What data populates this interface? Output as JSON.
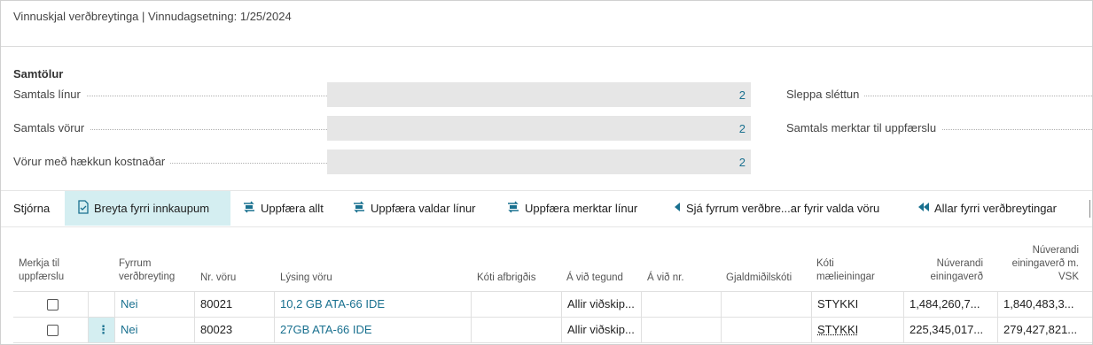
{
  "header": {
    "title": "Vinnuskjal verðbreytinga | Vinnudagsetning: 1/25/2024"
  },
  "summary": {
    "heading": "Samtölur",
    "left_fields": [
      {
        "label": "Samtals línur",
        "value": "2"
      },
      {
        "label": "Samtals vörur",
        "value": "2"
      },
      {
        "label": "Vörur með hækkun kostnaðar",
        "value": "2"
      }
    ],
    "right_fields": [
      {
        "label": "Sleppa sléttun"
      },
      {
        "label": "Samtals merktar til uppfærslu"
      }
    ]
  },
  "actions": {
    "manage": "Stjórna",
    "change_purchases": "Breyta fyrri innkaupum",
    "update_all": "Uppfæra allt",
    "update_selected": "Uppfæra valdar línur",
    "update_marked": "Uppfæra merktar línur",
    "view_previous": "Sjá fyrrum verðbre...ar fyrir valda vöru",
    "all_previous": "Allar fyrri verðbreytingar"
  },
  "table": {
    "columns": {
      "mark": [
        "Merkja til",
        "uppfærslu"
      ],
      "prev_change": [
        "Fyrrum",
        "verðbreyting"
      ],
      "item_no": "Nr. vöru",
      "description": "Lýsing vöru",
      "variant": "Kóti afbrigðis",
      "applies_type": "Á við tegund",
      "applies_no": "Á við nr.",
      "currency": "Gjaldmiðilskóti",
      "uom": [
        "Kóti",
        "mælieiningar"
      ],
      "unit_price": [
        "Núverandi",
        "einingaverð"
      ],
      "unit_price_vat": [
        "Núverandi",
        "einingaverð m.",
        "VSK"
      ]
    },
    "rows": [
      {
        "prev_change": "Nei",
        "item_no": "80021",
        "description": "10,2 GB ATA-66 IDE",
        "applies_type": "Allir viðskip...",
        "uom": "STYKKI",
        "unit_price": "1,484,260,7...",
        "unit_price_vat": "1,840,483,3..."
      },
      {
        "prev_change": "Nei",
        "item_no": "80023",
        "description": "27GB ATA-66 IDE",
        "applies_type": "Allir viðskip...",
        "uom": "STYKKI",
        "unit_price": "225,345,017...",
        "unit_price_vat": "279,427,821..."
      }
    ]
  },
  "colors": {
    "accent": "#19708f",
    "selected_bg": "#d4eef1",
    "field_bg": "#e6e6e6"
  }
}
